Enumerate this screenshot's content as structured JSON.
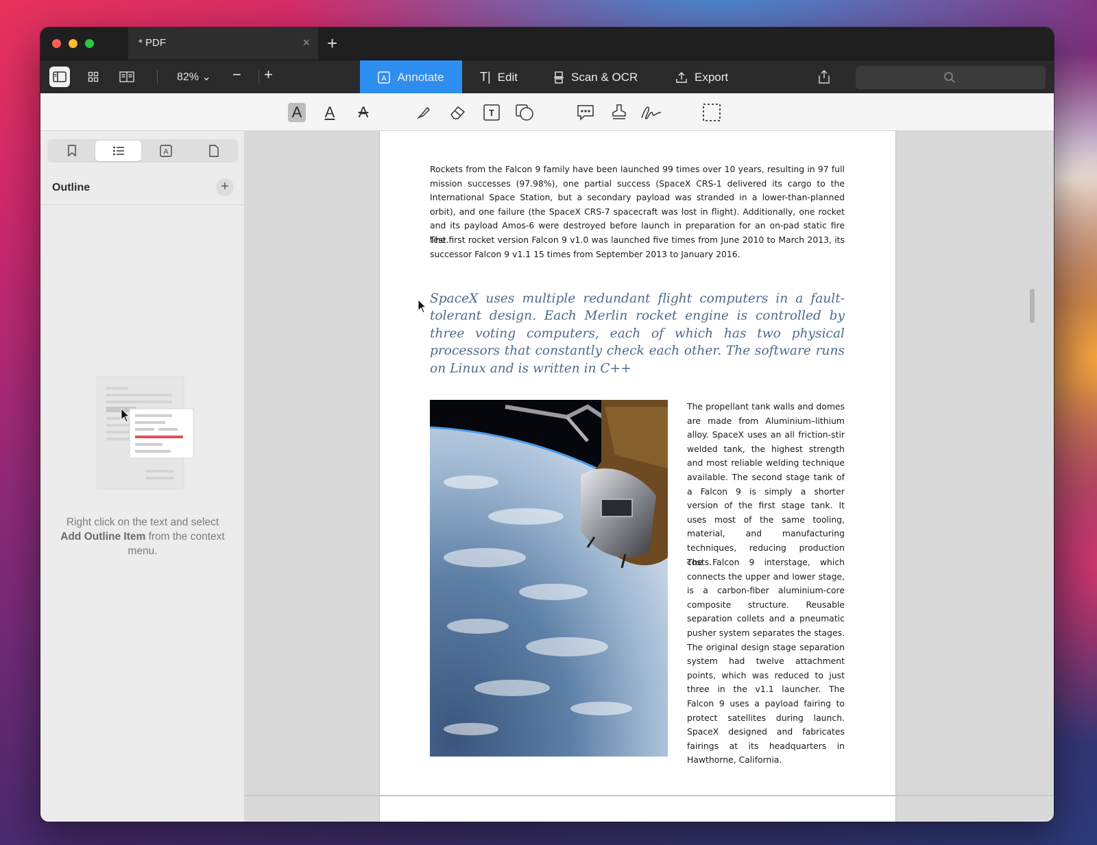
{
  "window": {
    "tab_title": "* PDF"
  },
  "toolbar": {
    "zoom": "82%",
    "modes": [
      {
        "label": "Annotate",
        "icon": "annotate-icon"
      },
      {
        "label": "Edit",
        "icon": "text-cursor-icon"
      },
      {
        "label": "Scan & OCR",
        "icon": "scan-icon"
      },
      {
        "label": "Export",
        "icon": "export-icon"
      }
    ],
    "active_mode": "Annotate"
  },
  "annotation_tools": [
    "text-highlight-icon",
    "text-underline-icon",
    "text-strikethrough-icon",
    "highlighter-icon",
    "eraser-icon",
    "text-box-icon",
    "shapes-icon",
    "comment-icon",
    "stamp-icon",
    "signature-icon",
    "selection-icon"
  ],
  "sidebar": {
    "tabs": [
      "bookmark-icon",
      "outline-list-icon",
      "annotations-icon",
      "page-icon"
    ],
    "selected_tab": "outline-list-icon",
    "title": "Outline",
    "hint_before": "Right click on the text and select ",
    "hint_bold": "Add Outline Item",
    "hint_after": " from the context menu."
  },
  "document": {
    "para1": "Rockets from the Falcon 9 family have been launched 99 times over 10 years, resulting in 97 full mission successes (97.98%), one partial success (SpaceX CRS-1 delivered its cargo to the International Space Station, but a secondary payload was stranded in a lower-than-planned orbit), and one failure (the SpaceX CRS-7 spacecraft was lost in flight). Additionally, one rocket and its payload Amos-6 were destroyed before launch in preparation for an on-pad static fire test.",
    "para2": "The first rocket version Falcon 9 v1.0 was launched five times from June 2010 to March 2013, its successor Falcon 9 v1.1 15 times from September 2013 to January 2016.",
    "quote": "SpaceX uses multiple redundant flight computers in a fault-tolerant design. Each Merlin rocket engine is controlled by three voting computers, each of which has two physical processors that constantly check each other. The software runs on Linux and is written in C++",
    "col_para1": "The propellant tank walls and domes are made from Aluminium–lithium alloy. SpaceX uses an all friction-stir welded tank, the highest strength and most reliable welding technique available. The second stage tank of a Falcon 9 is simply a shorter version of the first stage tank. It uses most of the same tooling, material, and manufacturing techniques, reducing production costs.",
    "col_para2": "The Falcon 9 interstage, which connects the upper and lower stage, is a carbon-fiber aluminium-core composite structure. Reusable separation collets and a pneumatic pusher system separates the stages. The original design stage separation system had twelve attachment points, which was reduced to just three in the v1.1 launcher. The Falcon 9 uses a payload fairing to protect satellites during launch. SpaceX designed and fabricates fairings at its headquarters in Hawthorne, California."
  },
  "colors": {
    "accent": "#2d8ef0",
    "quote": "#4d6a8e",
    "titlebar": "#1f1f1f",
    "toolbar": "#2a2a2a"
  }
}
